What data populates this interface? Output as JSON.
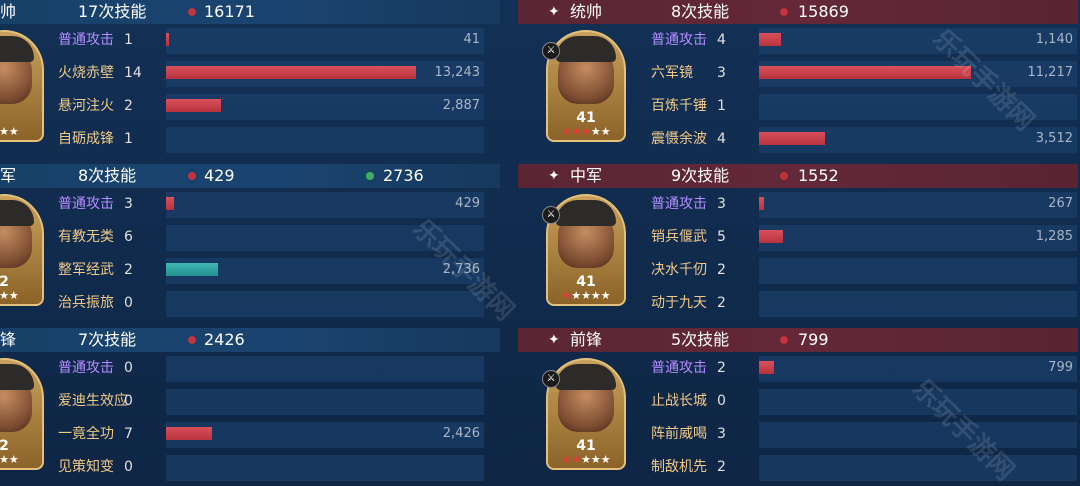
{
  "watermark": "乐玩手游网",
  "colors": {
    "red_bar": "#c8404b",
    "teal_bar": "#2fa3a2",
    "purple_text": "#b48cff",
    "gold_text": "#f0c987"
  },
  "left": [
    {
      "role": "帅",
      "casts": "17次技能",
      "damage": "16171",
      "heal": null,
      "portrait": {
        "level": "",
        "stars_gold": "★★★"
      },
      "skills": [
        {
          "name": "普通攻击",
          "type": "normal",
          "count": "1",
          "damage_label": "41",
          "damage_value": 41,
          "bar": "red"
        },
        {
          "name": "火烧赤壁",
          "type": "skill",
          "count": "14",
          "damage_label": "13,243",
          "damage_value": 13243,
          "bar": "red"
        },
        {
          "name": "悬河注火",
          "type": "skill",
          "count": "2",
          "damage_label": "2,887",
          "damage_value": 2887,
          "bar": "red"
        },
        {
          "name": "自砺成锋",
          "type": "skill",
          "count": "1",
          "damage_label": "",
          "damage_value": 0,
          "bar": "red"
        }
      ]
    },
    {
      "role": "军",
      "casts": "8次技能",
      "damage": "429",
      "heal": "2736",
      "portrait": {
        "level": "2",
        "stars_gold": "★★★"
      },
      "skills": [
        {
          "name": "普通攻击",
          "type": "normal",
          "count": "3",
          "damage_label": "429",
          "damage_value": 429,
          "bar": "red"
        },
        {
          "name": "有教无类",
          "type": "skill",
          "count": "6",
          "damage_label": "",
          "damage_value": 0,
          "bar": "red"
        },
        {
          "name": "整军经武",
          "type": "skill",
          "count": "2",
          "damage_label": "2,736",
          "damage_value": 2736,
          "bar": "teal"
        },
        {
          "name": "治兵振旅",
          "type": "skill",
          "count": "0",
          "damage_label": "",
          "damage_value": 0,
          "bar": "red"
        }
      ]
    },
    {
      "role": "锋",
      "casts": "7次技能",
      "damage": "2426",
      "heal": null,
      "portrait": {
        "level": "2",
        "stars_gold": "★★★"
      },
      "skills": [
        {
          "name": "普通攻击",
          "type": "normal",
          "count": "0",
          "damage_label": "",
          "damage_value": 0,
          "bar": "red"
        },
        {
          "name": "爱迪生效应",
          "type": "skill",
          "count": "0",
          "damage_label": "",
          "damage_value": 0,
          "bar": "red"
        },
        {
          "name": "一竟全功",
          "type": "skill",
          "count": "7",
          "damage_label": "2,426",
          "damage_value": 2426,
          "bar": "red"
        },
        {
          "name": "见策知变",
          "type": "skill",
          "count": "0",
          "damage_label": "",
          "damage_value": 0,
          "bar": "red"
        }
      ]
    }
  ],
  "right": [
    {
      "role": "统帅",
      "casts": "8次技能",
      "damage": "15869",
      "heal": null,
      "portrait": {
        "level": "41",
        "stars_red": "★★★",
        "stars_gold": "★★"
      },
      "skills": [
        {
          "name": "普通攻击",
          "type": "normal",
          "count": "4",
          "damage_label": "1,140",
          "damage_value": 1140,
          "bar": "red"
        },
        {
          "name": "六军镜",
          "type": "skill",
          "count": "3",
          "damage_label": "11,217",
          "damage_value": 11217,
          "bar": "red"
        },
        {
          "name": "百炼千锤",
          "type": "skill",
          "count": "1",
          "damage_label": "",
          "damage_value": 0,
          "bar": "red"
        },
        {
          "name": "震慑余波",
          "type": "skill",
          "count": "4",
          "damage_label": "3,512",
          "damage_value": 3512,
          "bar": "red"
        }
      ]
    },
    {
      "role": "中军",
      "casts": "9次技能",
      "damage": "1552",
      "heal": null,
      "portrait": {
        "level": "41",
        "stars_red": "★",
        "stars_gold": "★★★★"
      },
      "skills": [
        {
          "name": "普通攻击",
          "type": "normal",
          "count": "3",
          "damage_label": "267",
          "damage_value": 267,
          "bar": "red"
        },
        {
          "name": "销兵偃武",
          "type": "skill",
          "count": "5",
          "damage_label": "1,285",
          "damage_value": 1285,
          "bar": "red"
        },
        {
          "name": "决水千仞",
          "type": "skill",
          "count": "2",
          "damage_label": "",
          "damage_value": 0,
          "bar": "red"
        },
        {
          "name": "动于九天",
          "type": "skill",
          "count": "2",
          "damage_label": "",
          "damage_value": 0,
          "bar": "red"
        }
      ]
    },
    {
      "role": "前锋",
      "casts": "5次技能",
      "damage": "799",
      "heal": null,
      "portrait": {
        "level": "41",
        "stars_red": "★★",
        "stars_gold": "★★★"
      },
      "skills": [
        {
          "name": "普通攻击",
          "type": "normal",
          "count": "2",
          "damage_label": "799",
          "damage_value": 799,
          "bar": "red"
        },
        {
          "name": "止战长城",
          "type": "skill",
          "count": "0",
          "damage_label": "",
          "damage_value": 0,
          "bar": "red"
        },
        {
          "name": "阵前威喝",
          "type": "skill",
          "count": "3",
          "damage_label": "",
          "damage_value": 0,
          "bar": "red"
        },
        {
          "name": "制敌机先",
          "type": "skill",
          "count": "2",
          "damage_label": "",
          "damage_value": 0,
          "bar": "red"
        }
      ]
    }
  ]
}
